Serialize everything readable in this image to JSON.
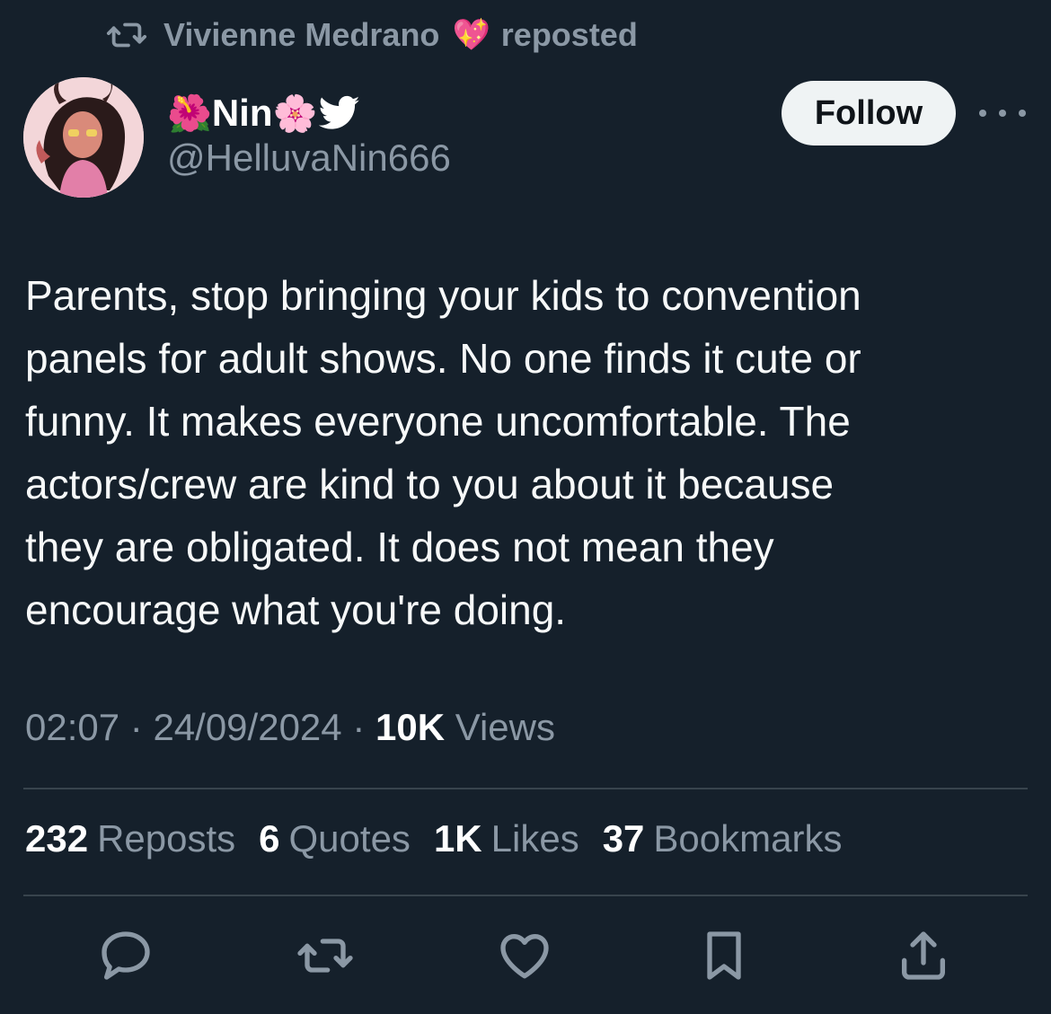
{
  "repost": {
    "icon": "repost-icon",
    "user": "Vivienne Medrano",
    "emoji": "💖",
    "label": "reposted"
  },
  "author": {
    "avatar": "avatar",
    "flower_left": "🌺",
    "name": "Nin",
    "flower_right": "🌸",
    "bird_icon": "twitter-bird-icon",
    "handle": "@HelluvaNin666"
  },
  "follow_label": "Follow",
  "more_icon": "more-icon",
  "tweet_lines": [
    "Parents, stop bringing your kids to convention",
    "panels for adult shows. No one finds it cute or",
    "funny. It makes everyone uncomfortable. The",
    "actors/crew are kind to you about it because",
    "they are obligated. It does not mean they",
    "encourage what you're doing."
  ],
  "meta": {
    "time": "02:07",
    "sep1": " · ",
    "date": "24/09/2024",
    "sep2": " · ",
    "views_count": "10K",
    "views_label": " Views"
  },
  "stats": [
    {
      "count": "232",
      "label": "Reposts"
    },
    {
      "count": "6",
      "label": "Quotes"
    },
    {
      "count": "1K",
      "label": "Likes"
    },
    {
      "count": "37",
      "label": "Bookmarks"
    }
  ],
  "actions": [
    "reply-icon",
    "repost-icon",
    "like-icon",
    "bookmark-icon",
    "share-icon"
  ],
  "colors": {
    "background": "#15202b",
    "secondary_text": "#8b98a5",
    "divider": "#38444d",
    "follow_bg": "#eff3f4"
  }
}
